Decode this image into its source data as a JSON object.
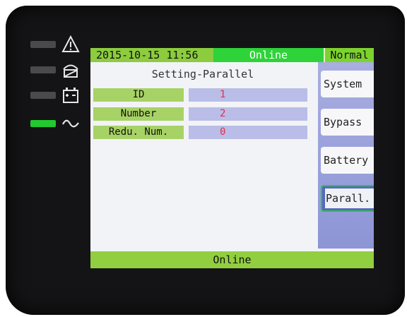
{
  "indicators": [
    {
      "name": "fault",
      "state": "off",
      "icon": "warning-icon"
    },
    {
      "name": "bypass",
      "state": "off",
      "icon": "bypass-icon"
    },
    {
      "name": "battery",
      "state": "off",
      "icon": "battery-icon"
    },
    {
      "name": "inverter",
      "state": "on",
      "icon": "sine-wave-icon"
    }
  ],
  "header": {
    "datetime": "2015-10-15 11:56",
    "status": "Online",
    "mode": "Normal"
  },
  "page": {
    "title": "Setting-Parallel",
    "rows": [
      {
        "label": "ID",
        "value": "1"
      },
      {
        "label": "Number",
        "value": "2"
      },
      {
        "label": "Redu. Num.",
        "value": "0"
      }
    ]
  },
  "sidebar": {
    "items": [
      "System",
      "Bypass",
      "Battery",
      "Parall."
    ],
    "selected": "Parall."
  },
  "footer": {
    "status": "Online"
  },
  "colors": {
    "led_on": "#22c92f",
    "led_off": "#4a4a4c",
    "value_text": "#e0304a",
    "status_green": "#2ed33a"
  }
}
